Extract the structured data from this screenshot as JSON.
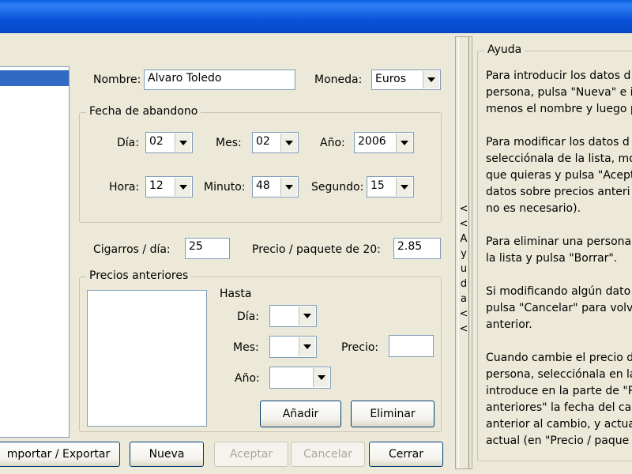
{
  "form": {
    "nombre_label": "Nombre:",
    "nombre_value": "Alvaro Toledo",
    "moneda_label": "Moneda:",
    "moneda_value": "Euros"
  },
  "fecha": {
    "legend": "Fecha de abandono",
    "dia_label": "Día:",
    "dia_value": "02",
    "mes_label": "Mes:",
    "mes_value": "02",
    "anio_label": "Año:",
    "anio_value": "2006",
    "hora_label": "Hora:",
    "hora_value": "12",
    "minuto_label": "Minuto:",
    "minuto_value": "48",
    "segundo_label": "Segundo:",
    "segundo_value": "15"
  },
  "consumo": {
    "cigarros_label": "Cigarros / día:",
    "cigarros_value": "25",
    "precio_label": "Precio / paquete de 20:",
    "precio_value": "2.85"
  },
  "precios": {
    "legend": "Precios anteriores",
    "hasta_label": "Hasta",
    "dia_label": "Día:",
    "mes_label": "Mes:",
    "anio_label": "Año:",
    "precio_label": "Precio:",
    "anadir_label": "Añadir",
    "eliminar_label": "Eliminar"
  },
  "toolbar": {
    "importar_label": "mportar / Exportar",
    "nueva_label": "Nueva",
    "aceptar_label": "Aceptar",
    "cancelar_label": "Cancelar",
    "cerrar_label": "Cerrar"
  },
  "splitter": {
    "chars": [
      "<",
      "<",
      "A",
      "y",
      "u",
      "d",
      "a",
      "<",
      "<"
    ]
  },
  "ayuda": {
    "legend": "Ayuda",
    "lines": [
      "Para introducir los datos d",
      "persona, pulsa \"Nueva\" e i",
      "menos el nombre y luego pu",
      "",
      "Para modificar los datos d",
      "selecciónala de la lista, mo",
      "que quieras y pulsa \"Acept",
      "datos sobre precios anteri",
      "no es necesario).",
      "",
      "Para eliminar una persona",
      "la lista y pulsa \"Borrar\".",
      "",
      "Si modificando algún dato",
      "pulsa \"Cancelar\" para volv",
      "anterior.",
      "",
      "Cuando cambie el precio d",
      "persona, selecciónala en la",
      "introduce en la parte de \"P",
      "anteriores\" la fecha del ca",
      "anterior al cambio, y actua",
      "actual (en \"Precio / paque"
    ]
  }
}
